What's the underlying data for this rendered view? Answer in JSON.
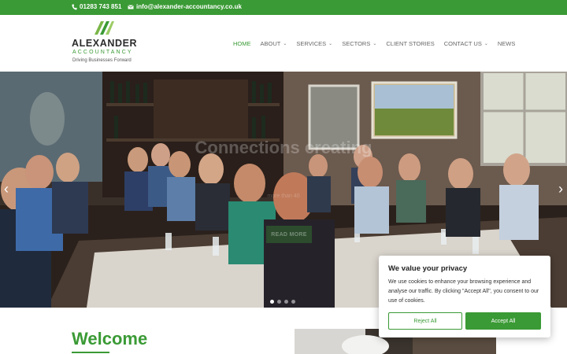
{
  "topbar": {
    "phone": "01283 743 851",
    "email": "info@alexander-accountancy.co.uk",
    "phone_icon": "phone-icon",
    "email_icon": "envelope-icon"
  },
  "logo": {
    "brand": "ALEXANDER",
    "sub": "ACCOUNTANCY",
    "tagline": "Driving Businesses Forward"
  },
  "nav": {
    "items": [
      {
        "label": "HOME",
        "active": true,
        "dropdown": false
      },
      {
        "label": "ABOUT",
        "active": false,
        "dropdown": true
      },
      {
        "label": "SERVICES",
        "active": false,
        "dropdown": true
      },
      {
        "label": "SECTORS",
        "active": false,
        "dropdown": true
      },
      {
        "label": "CLIENT STORIES",
        "active": false,
        "dropdown": false
      },
      {
        "label": "CONTACT US",
        "active": false,
        "dropdown": true
      },
      {
        "label": "NEWS",
        "active": false,
        "dropdown": false
      }
    ]
  },
  "hero": {
    "headline": "Connections creating",
    "subline": "more than 40",
    "button": "READ MORE",
    "prev_icon": "chevron-left-icon",
    "next_icon": "chevron-right-icon",
    "slides": 4,
    "active_slide": 1
  },
  "welcome": {
    "title": "Welcome"
  },
  "cookie": {
    "title": "We value your privacy",
    "body": "We use cookies to enhance your browsing experience and analyse our traffic. By clicking \"Accept All\", you consent to our use of cookies.",
    "reject": "Reject All",
    "accept": "Accept All"
  },
  "colors": {
    "brand_green": "#3a9a35",
    "text_dark": "#222222"
  }
}
